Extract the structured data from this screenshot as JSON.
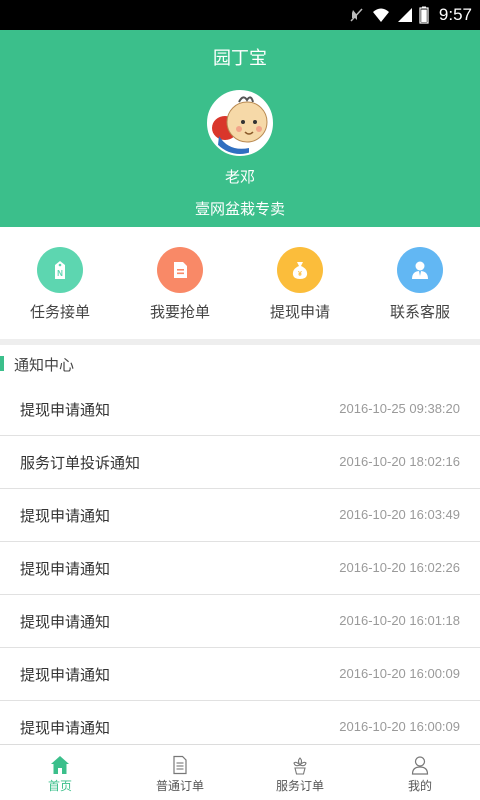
{
  "status_bar": {
    "time": "9:57",
    "icons": [
      "mute-icon",
      "wifi-icon",
      "signal-icon",
      "battery-icon"
    ]
  },
  "header": {
    "app_title": "园丁宝",
    "user_name": "老邓",
    "shop_name": "壹网盆栽专卖",
    "background_color": "#3bbf8b"
  },
  "quick_actions": [
    {
      "label": "任务接单",
      "icon": "task-tag-icon",
      "color": "#5dd6b0"
    },
    {
      "label": "我要抢单",
      "icon": "document-icon",
      "color": "#f98967"
    },
    {
      "label": "提现申请",
      "icon": "money-bag-icon",
      "color": "#fbbd3b"
    },
    {
      "label": "联系客服",
      "icon": "customer-service-icon",
      "color": "#62b7f3"
    }
  ],
  "notifications": {
    "title": "通知中心",
    "items": [
      {
        "title": "提现申请通知",
        "time": "2016-10-25 09:38:20"
      },
      {
        "title": "服务订单投诉通知",
        "time": "2016-10-20 18:02:16"
      },
      {
        "title": "提现申请通知",
        "time": "2016-10-20 16:03:49"
      },
      {
        "title": "提现申请通知",
        "time": "2016-10-20 16:02:26"
      },
      {
        "title": "提现申请通知",
        "time": "2016-10-20 16:01:18"
      },
      {
        "title": "提现申请通知",
        "time": "2016-10-20 16:00:09"
      },
      {
        "title": "提现申请通知",
        "time": "2016-10-20 16:00:09"
      }
    ]
  },
  "bottom_nav": [
    {
      "label": "首页",
      "icon": "home-icon",
      "active": true
    },
    {
      "label": "普通订单",
      "icon": "order-list-icon",
      "active": false
    },
    {
      "label": "服务订单",
      "icon": "flower-icon",
      "active": false
    },
    {
      "label": "我的",
      "icon": "user-icon",
      "active": false
    }
  ]
}
